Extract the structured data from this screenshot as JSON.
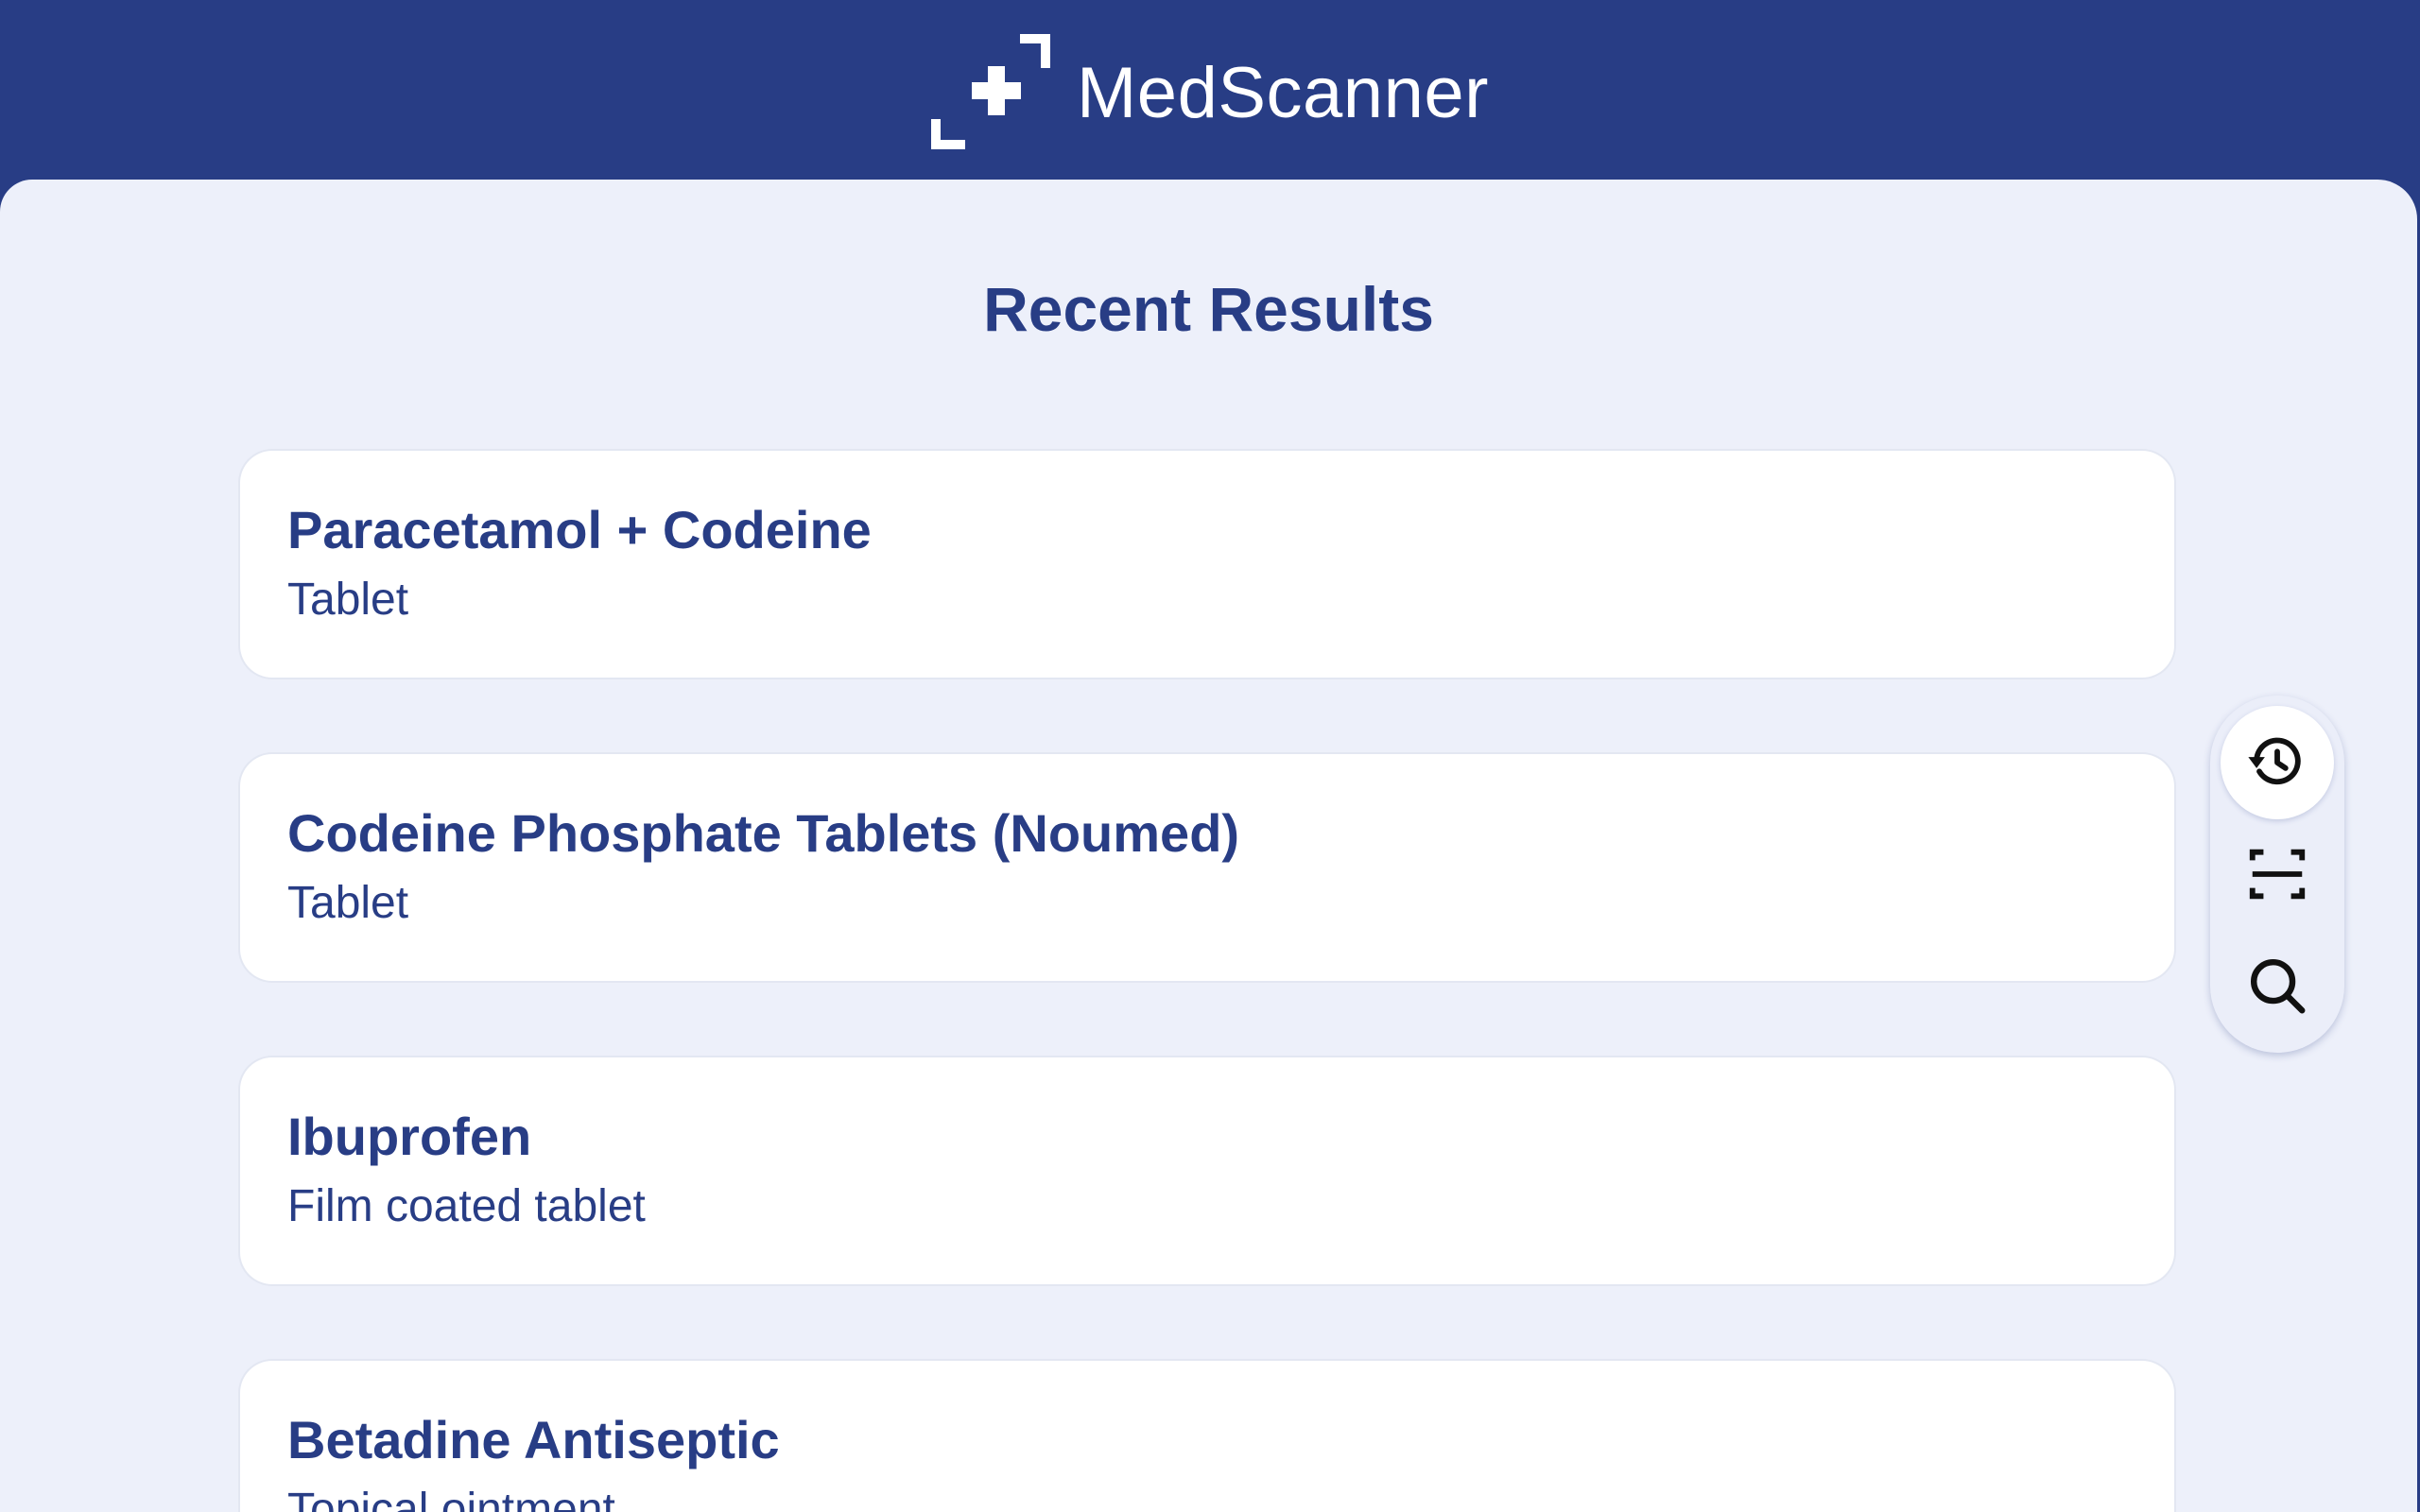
{
  "app": {
    "name": "MedScanner",
    "logo_icon": "medical-cross-logo-icon"
  },
  "colors": {
    "brand": "#283d85",
    "background": "#edf0fa",
    "card": "#ffffff"
  },
  "main": {
    "title": "Recent Results",
    "results": [
      {
        "name": "Paracetamol + Codeine",
        "form": "Tablet"
      },
      {
        "name": "Codeine Phosphate Tablets (Noumed)",
        "form": "Tablet"
      },
      {
        "name": "Ibuprofen",
        "form": "Film coated tablet"
      },
      {
        "name": "Betadine Antiseptic",
        "form": "Topical ointment"
      }
    ]
  },
  "fab_menu": {
    "items": [
      {
        "icon": "history-icon",
        "active": true
      },
      {
        "icon": "scan-icon",
        "active": false
      },
      {
        "icon": "search-icon",
        "active": false
      }
    ]
  }
}
